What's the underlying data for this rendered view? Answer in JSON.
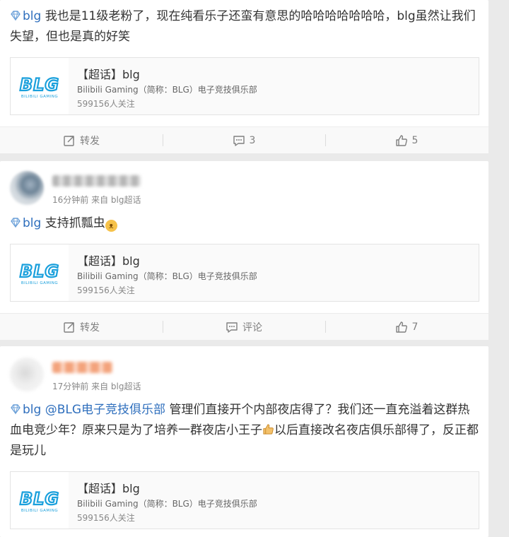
{
  "colors": {
    "topic_blue": "#2f6fbd",
    "logo_blue": "#1aa0dc",
    "meta_gray": "#888888"
  },
  "posts": [
    {
      "topic": "blg",
      "text": "我也是11级老粉了，现在纯看乐子还蛮有意思的哈哈哈哈哈哈哈，blg虽然让我们失望，但也是真的好笑",
      "share": {
        "title": "【超话】blg",
        "desc": "Bilibili Gaming（简称：BLG）电子竞技俱乐部",
        "fans": "599156人关注"
      },
      "actions": {
        "repost": "转发",
        "comment": "3",
        "like": "5"
      }
    },
    {
      "meta": "16分钟前 来自 blg超话",
      "topic": "blg",
      "text": "支持抓瓢虫",
      "emoji": "cat-face-emoji",
      "share": {
        "title": "【超话】blg",
        "desc": "Bilibili Gaming（简称：BLG）电子竞技俱乐部",
        "fans": "599156人关注"
      },
      "actions": {
        "repost": "转发",
        "comment": "评论",
        "like": "7"
      }
    },
    {
      "meta": "17分钟前 来自 blg超话",
      "topic": "blg",
      "mention": "@BLG电子竞技俱乐部",
      "text_a": "管理们直接开个内部夜店得了？我们还一直充溢着这群热血电竞少年？原来只是为了培养一群夜店小王子",
      "emoji": "thumbs-up-emoji",
      "text_b": "以后直接改名夜店俱乐部得了，反正都是玩儿",
      "share": {
        "title": "【超话】blg",
        "desc": "Bilibili Gaming（简称：BLG）电子竞技俱乐部",
        "fans": "599156人关注"
      }
    }
  ],
  "logo": {
    "main": "BLG",
    "sub": "BILIBILI GAMING"
  }
}
